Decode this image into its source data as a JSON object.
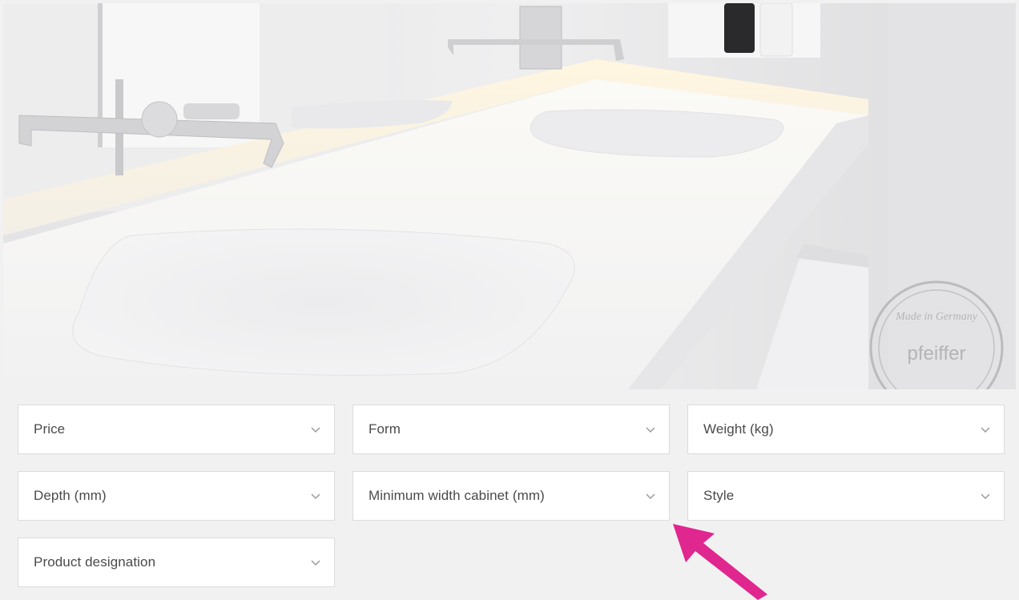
{
  "hero": {
    "image_description_icon": "bathroom-vanity-photo",
    "watermark": "Made in Germany pfeiffer"
  },
  "filters": [
    {
      "label": "Price",
      "icon": "chevron-down-icon"
    },
    {
      "label": "Form",
      "icon": "chevron-down-icon"
    },
    {
      "label": "Weight (kg)",
      "icon": "chevron-down-icon"
    },
    {
      "label": "Depth (mm)",
      "icon": "chevron-down-icon"
    },
    {
      "label": "Minimum width cabinet (mm)",
      "icon": "chevron-down-icon"
    },
    {
      "label": "Style",
      "icon": "chevron-down-icon"
    },
    {
      "label": "Product designation",
      "icon": "chevron-down-icon"
    }
  ],
  "colors": {
    "background": "#f1f1f1",
    "dropdown_bg": "#ffffff",
    "dropdown_border": "#dcdcdc",
    "text": "#4a4a4a",
    "chevron": "#9a9a9a",
    "annotation_arrow": "#e0268f"
  }
}
